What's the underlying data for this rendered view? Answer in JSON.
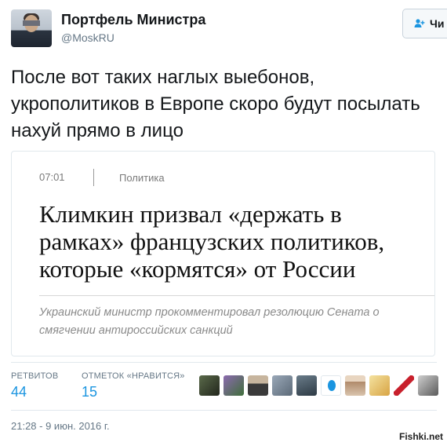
{
  "user": {
    "name": "Портфель Министра",
    "handle": "@MoskRU"
  },
  "follow_button": {
    "label": "Чи"
  },
  "tweet": {
    "text": "После вот таких наглых выебонов, укрополитиков в Европе скоро будут посылать нахуй прямо в лицо"
  },
  "card": {
    "time": "07:01",
    "category": "Политика",
    "headline": "Климкин призвал «держать в рамках» французских политиков, которые «кормятся» от России",
    "subtitle": "Украинский министр прокомментировал резолюцию Сената о смягчении антироссийских санкций"
  },
  "stats": {
    "retweets_label": "РЕТВИТОВ",
    "retweets_value": "44",
    "likes_label": "ОТМЕТОК «НРАВИТСЯ»",
    "likes_value": "15"
  },
  "timestamp": "21:28 - 9 июн. 2016 г.",
  "watermark": "Fishki.net",
  "colors": {
    "link": "#1b95e0",
    "muted": "#657786",
    "border": "#e1e8ed"
  },
  "icons": {
    "follow": "add-user-icon"
  }
}
